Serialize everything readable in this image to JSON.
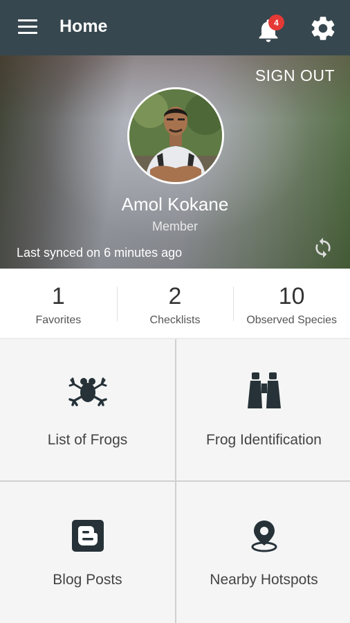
{
  "app_bar": {
    "title": "Home",
    "notification_count": "4",
    "icons": [
      "menu-icon",
      "bell-icon",
      "gear-icon"
    ],
    "color": "#37474f",
    "badge_color": "#e53935"
  },
  "profile": {
    "sign_out_label": "SIGN OUT",
    "name": "Amol Kokane",
    "role": "Member",
    "sync_status": "Last synced on 6 minutes ago"
  },
  "stats": [
    {
      "value": "1",
      "label": "Favorites"
    },
    {
      "value": "2",
      "label": "Checklists"
    },
    {
      "value": "10",
      "label": "Observed Species"
    }
  ],
  "tiles": [
    {
      "label": "List of Frogs",
      "icon": "frog-icon"
    },
    {
      "label": "Frog Identification",
      "icon": "binoculars-icon"
    },
    {
      "label": "Blog Posts",
      "icon": "blogger-icon"
    },
    {
      "label": "Nearby Hotspots",
      "icon": "location-pin-icon"
    }
  ]
}
